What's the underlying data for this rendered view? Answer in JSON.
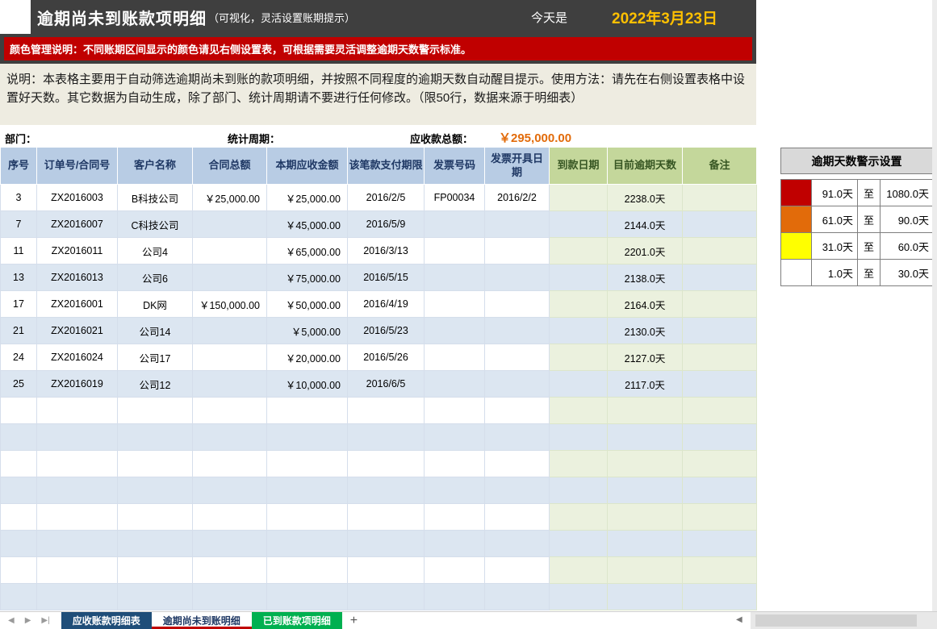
{
  "colors": {
    "titlebar_bg": "#3F3F3F",
    "notice_bg": "#C00000",
    "date_color": "#FFC000",
    "total_color": "#E26B0A",
    "header_blue": "#B8CCE4",
    "header_green": "#C4D79B",
    "stripe_blue": "#DCE6F1",
    "cell_green": "#EBF1DE"
  },
  "header": {
    "title": "逾期尚未到账款项明细",
    "subtitle": "（可视化，灵活设置账期提示）",
    "today_label": "今天是",
    "date": "2022年3月23日"
  },
  "notice": "颜色管理说明：不同账期区间显示的颜色请见右侧设置表，可根据需要灵活调整逾期天数警示标准。",
  "description": "说明：本表格主要用于自动筛选逾期尚未到账的款项明细，并按照不同程度的逾期天数自动醒目提示。使用方法：请先在右侧设置表格中设置好天数。其它数据为自动生成，除了部门、统计周期请不要进行任何修改。（限50行，数据来源于明细表）",
  "info": {
    "department_label": "部门：",
    "period_label": "统计周期：",
    "total_label": "应收款总额：",
    "total_value": "￥295,000.00"
  },
  "table": {
    "col_keys": [
      "seq",
      "order-no",
      "customer",
      "contract-total",
      "receivable",
      "due-date",
      "invoice-no",
      "invoice-date",
      "received-date",
      "overdue-days",
      "note"
    ],
    "headers": [
      "序号",
      "订单号/合同号",
      "客户名称",
      "合同总额",
      "本期应收金额",
      "该笔款支付期限",
      "发票号码",
      "发票开具日期",
      "到款日期",
      "目前逾期天数",
      "备注"
    ],
    "rows": [
      [
        "3",
        "ZX2016003",
        "B科技公司",
        "￥25,000.00",
        "￥25,000.00",
        "2016/2/5",
        "FP00034",
        "2016/2/2",
        "",
        "2238.0天",
        ""
      ],
      [
        "7",
        "ZX2016007",
        "C科技公司",
        "",
        "￥45,000.00",
        "2016/5/9",
        "",
        "",
        "",
        "2144.0天",
        ""
      ],
      [
        "11",
        "ZX2016011",
        "公司4",
        "",
        "￥65,000.00",
        "2016/3/13",
        "",
        "",
        "",
        "2201.0天",
        ""
      ],
      [
        "13",
        "ZX2016013",
        "公司6",
        "",
        "￥75,000.00",
        "2016/5/15",
        "",
        "",
        "",
        "2138.0天",
        ""
      ],
      [
        "17",
        "ZX2016001",
        "DK网",
        "￥150,000.00",
        "￥50,000.00",
        "2016/4/19",
        "",
        "",
        "",
        "2164.0天",
        ""
      ],
      [
        "21",
        "ZX2016021",
        "公司14",
        "",
        "￥5,000.00",
        "2016/5/23",
        "",
        "",
        "",
        "2130.0天",
        ""
      ],
      [
        "24",
        "ZX2016024",
        "公司17",
        "",
        "￥20,000.00",
        "2016/5/26",
        "",
        "",
        "",
        "2127.0天",
        ""
      ],
      [
        "25",
        "ZX2016019",
        "公司12",
        "",
        "￥10,000.00",
        "2016/6/5",
        "",
        "",
        "",
        "2117.0天",
        ""
      ]
    ],
    "empty_row_count": 8
  },
  "settings": {
    "title": "逾期天数警示设置",
    "rows": [
      {
        "color": "#C00000",
        "from": "91.0天",
        "to_label": "至",
        "to": "1080.0天"
      },
      {
        "color": "#E26B0A",
        "from": "61.0天",
        "to_label": "至",
        "to": "90.0天"
      },
      {
        "color": "#FFFF00",
        "from": "31.0天",
        "to_label": "至",
        "to": "60.0天"
      },
      {
        "color": "#FFFFFF",
        "from": "1.0天",
        "to_label": "至",
        "to": "30.0天"
      }
    ]
  },
  "tabbar": {
    "nav_icons": [
      "◀",
      "▶",
      "▶|"
    ],
    "tabs": [
      {
        "label": "应收账款明细表",
        "bg": "#1F4E79",
        "active": false
      },
      {
        "label": "逾期尚未到账明细",
        "bg": "#FFFFFF",
        "active": true
      },
      {
        "label": "已到账款项明细",
        "bg": "#00B050",
        "active": false
      }
    ],
    "add_label": "+",
    "split_arrow": "◀"
  }
}
